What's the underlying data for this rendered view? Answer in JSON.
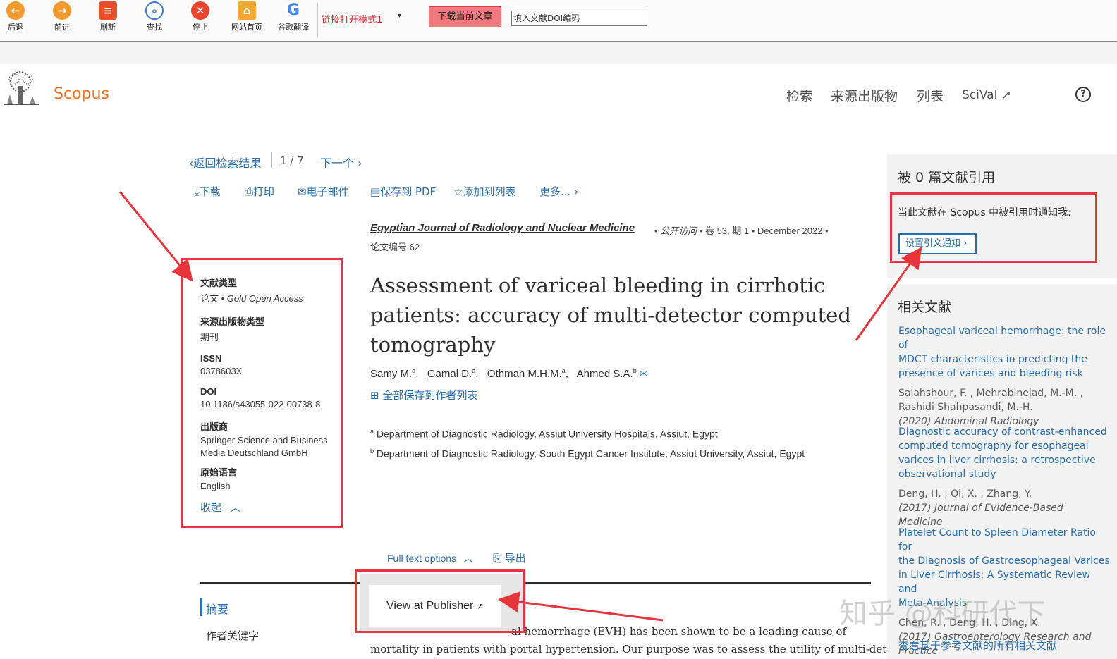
{
  "toolbar": {
    "back": "后退",
    "forward": "前进",
    "refresh": "刷新",
    "find": "查找",
    "stop": "停止",
    "home": "网站首页",
    "translate": "谷歌翻译",
    "mode_select": "链接打开模式1",
    "download_button": "下载当前文章",
    "doi_placeholder": "填入文献DOI编码"
  },
  "header": {
    "logo": "Scopus",
    "nav": [
      "检索",
      "来源出版物",
      "列表",
      "SciVal ↗"
    ],
    "help_icon": "?"
  },
  "results_nav": {
    "back": "返回检索结果",
    "position": "1 / 7",
    "next": "下一个"
  },
  "actions": {
    "download": "下载",
    "print": "打印",
    "email": "电子邮件",
    "save_pdf": "保存到 PDF",
    "add_list": "添加到列表",
    "more": "更多..."
  },
  "source": {
    "journal": "Egyptian Journal of Radiology and Nuclear Medicine",
    "access": "公开访问",
    "volume": "卷 53, 期 1",
    "date": "December 2022",
    "article_no": "论文编号 62"
  },
  "article": {
    "title_line1": "Assessment of variceal bleeding in cirrhotic",
    "title_line2": "patients: accuracy of multi-detector computed",
    "title_line3": "tomography",
    "authors": [
      "Samy M.",
      "Gamal D.",
      "Othman M.H.M.",
      "Ahmed S.A."
    ],
    "author_sup": [
      "a",
      "a",
      "a",
      "b"
    ],
    "save_authors": "全部保存到作者列表",
    "aff_a_sup": "a",
    "aff_a": "Department of Diagnostic Radiology, Assiut University Hospitals, Assiut, Egypt",
    "aff_b_sup": "b",
    "aff_b": "Department of Diagnostic Radiology, South Egypt Cancer Institute, Assiut University, Assiut, Egypt"
  },
  "metadata": {
    "doc_type_label": "文献类型",
    "doc_type_value": "论文 •",
    "doc_type_access": "Gold Open Access",
    "source_type_label": "来源出版物类型",
    "source_type_value": "期刊",
    "issn_label": "ISSN",
    "issn_value": "0378603X",
    "doi_label": "DOI",
    "doi_value": "10.1186/s43055-022-00738-8",
    "publisher_label": "出版商",
    "publisher_line1": "Springer Science and Business",
    "publisher_line2": "Media Deutschland GmbH",
    "language_label": "原始语言",
    "language_value": "English",
    "collapse": "收起"
  },
  "fulltext": {
    "options": "Full text options",
    "export": "导出",
    "view_publisher": "View at Publisher"
  },
  "abstract": {
    "tab_abstract": "摘要",
    "tab_keywords": "作者关键字",
    "text_line1": "al hemorrhage (EVH) has been shown to be a leading cause of",
    "text_line2": "mortality in patients with portal hypertension. Our purpose was to assess the utility of multi-detector"
  },
  "sidebar": {
    "cited_title": "被 0 篇文献引用",
    "notify_text": "当此文献在 Scopus 中被引用时通知我:",
    "set_alert": "设置引文通知",
    "related_title": "相关文献",
    "related": [
      {
        "t1": "Esophageal variceal hemorrhage: the role of",
        "t2": "MDCT characteristics in predicting the",
        "t3": "presence of varices and bleeding risk",
        "a1": "Salahshour, F. , Mehrabinejad, M.-M. ,",
        "a2": "Rashidi Shahpasandi, M.-H.",
        "src": "(2020) Abdominal Radiology"
      },
      {
        "t1": "Diagnostic accuracy of contrast-enhanced",
        "t2": "computed tomography for esophageal",
        "t3": "varices in liver cirrhosis: a retrospective",
        "t4": "observational study",
        "a1": "Deng, H. , Qi, X. , Zhang, Y.",
        "src": "(2017) Journal of Evidence-Based Medicine"
      },
      {
        "t1": "Platelet Count to Spleen Diameter Ratio for",
        "t2": "the Diagnosis of Gastroesophageal Varices",
        "t3": "in Liver Cirrhosis: A Systematic Review and",
        "t4": "Meta-Analysis",
        "a1": "Chen, R. , Deng, H. , Ding, X.",
        "src": "(2017) Gastroenterology Research and",
        "src2": "Practice"
      }
    ],
    "view_all": "查看基于参考文献的所有相关文献"
  },
  "watermark": "知乎 @科研代下"
}
